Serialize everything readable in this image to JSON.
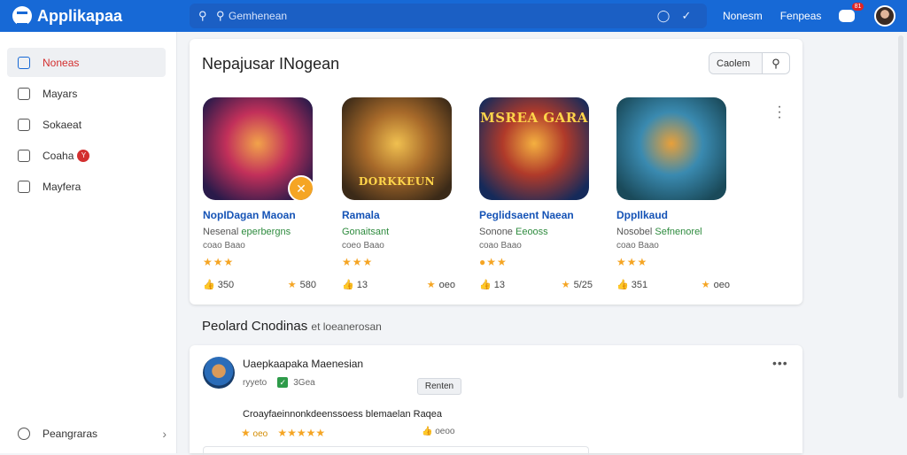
{
  "app": {
    "name": "Applikapaa"
  },
  "search": {
    "placeholder": "Gemhenean"
  },
  "top_links": [
    "Nonesm",
    "Fenpeas"
  ],
  "notif_badge": "81",
  "sidebar": {
    "items": [
      {
        "label": "Noneas",
        "active": true
      },
      {
        "label": "Mayars"
      },
      {
        "label": "Sokaeat"
      },
      {
        "label": "Coaha",
        "badge": "Y"
      },
      {
        "label": "Mayfera"
      }
    ],
    "bottom": "Peangraras"
  },
  "featured": {
    "title": "Nepajusar INogean",
    "search_label": "Caolem",
    "cards": [
      {
        "name": "NopIDagan Maoan",
        "sub_prefix": "Nesenal ",
        "sub_highlight": "eperbergns",
        "size": "coao Baao",
        "stars": "★★★",
        "likes": "350",
        "rating": "580",
        "thumb_label": "",
        "thumb_colors": [
          "#2a1a4a",
          "#c2305a",
          "#f2a34a"
        ]
      },
      {
        "name": "Ramala",
        "sub_prefix": "",
        "sub_highlight": "Gonaitsant",
        "size": "coeo Baao",
        "stars": "★★★",
        "likes": "13",
        "rating": "oeo",
        "thumb_label": "DORKKEUN",
        "thumb_colors": [
          "#3b2a18",
          "#a86a2a",
          "#f0c050"
        ]
      },
      {
        "name": "Peglidsaent Naean",
        "sub_prefix": "Sonone ",
        "sub_highlight": "Eeooss",
        "size": "coao Baao",
        "stars": "●★★",
        "likes": "13",
        "rating": "5/25",
        "thumb_label": "MSREA GARA",
        "thumb_colors": [
          "#152a5a",
          "#b03a2a",
          "#f4b040"
        ]
      },
      {
        "name": "DppIlkaud",
        "sub_prefix": "Nosobel ",
        "sub_highlight": "Sefnenorel",
        "size": "coao Baao",
        "stars": "★★★",
        "likes": "351",
        "rating": "oeo",
        "thumb_label": "",
        "thumb_colors": [
          "#1a4a5a",
          "#3a8ab0",
          "#e8a03a"
        ]
      }
    ]
  },
  "recent": {
    "title": "Peolard Cnodinas",
    "subtitle": "et loeanerosan"
  },
  "review": {
    "name": "Uaepkaapaka Maenesian",
    "handle": "ryyeto",
    "time": "3Gea",
    "button": "Renten",
    "text": "Croayfaeinnonkdeenssoess blemaelan Raqea",
    "stars_text": "oeo",
    "likes": "oeoo"
  }
}
